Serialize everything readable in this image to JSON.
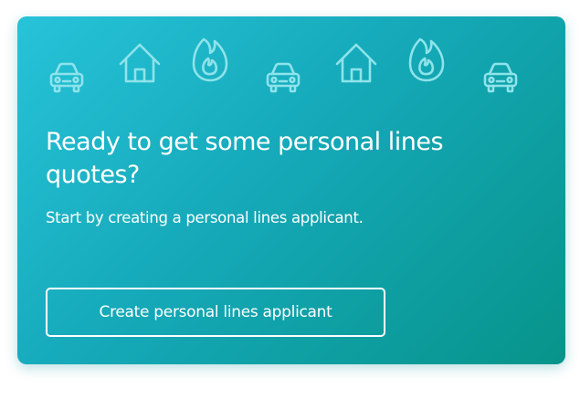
{
  "card": {
    "icons": [
      "car-icon",
      "house-icon",
      "flame-icon",
      "car-icon",
      "house-icon",
      "flame-icon",
      "car-icon"
    ],
    "title": "Ready to get some personal lines quotes?",
    "subtitle": "Start by creating a personal lines applicant.",
    "button_label": "Create personal lines applicant"
  },
  "colors": {
    "gradient_start": "#27c3d9",
    "gradient_end": "#07948a",
    "icon_stroke": "#8fe3ea",
    "text": "#ffffff"
  }
}
